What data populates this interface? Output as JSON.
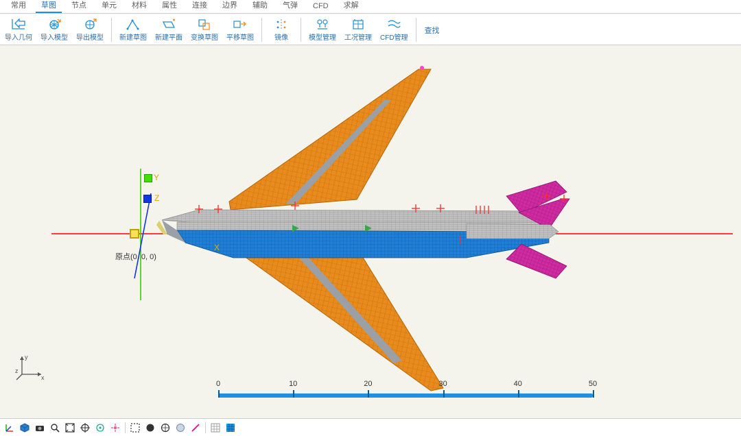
{
  "menu": {
    "tabs": [
      "常用",
      "草图",
      "节点",
      "单元",
      "材料",
      "属性",
      "连接",
      "边界",
      "辅助",
      "气弹",
      "CFD",
      "求解"
    ],
    "active_index": 1
  },
  "ribbon": {
    "buttons": [
      {
        "icon": "import-geometry",
        "label": "导入几何"
      },
      {
        "icon": "import-model",
        "label": "导入模型"
      },
      {
        "icon": "export-model",
        "label": "导出模型"
      },
      {
        "icon": "new-sketch",
        "label": "新建草图"
      },
      {
        "icon": "new-plane",
        "label": "新建平面"
      },
      {
        "icon": "transform-sketch",
        "label": "变换草图"
      },
      {
        "icon": "translate-sketch",
        "label": "平移草图"
      },
      {
        "icon": "mirror",
        "label": "镜像"
      },
      {
        "icon": "model-manage",
        "label": "模型管理"
      },
      {
        "icon": "loadcase-manage",
        "label": "工况管理"
      },
      {
        "icon": "cfd-manage",
        "label": "CFD管理"
      }
    ],
    "search_label": "查找",
    "separators_after": [
      2,
      6,
      7,
      10
    ]
  },
  "viewport": {
    "origin_label": "原点(0, 0, 0)",
    "axes": {
      "x": "X",
      "y": "Y",
      "z": "Z"
    },
    "triad": {
      "x": "x",
      "y": "y",
      "z": "z"
    },
    "ruler": {
      "ticks": [
        0,
        10,
        20,
        30,
        40,
        50
      ]
    },
    "colors": {
      "wing": "#e88b1f",
      "wing_grid": "#b86500",
      "fuselage_top": "#bcbcbc",
      "fuselage_grid": "#8f8f8f",
      "fuselage_bottom": "#1f7fd6",
      "fuselage_bottom_grid": "#0d4e8a",
      "tail": "#cf2aa0",
      "tail_grid": "#8d1670",
      "axis_x": "#ff0000",
      "axis_y": "#2fd000",
      "axis_z": "#1037e2"
    }
  },
  "bottom_toolbar": {
    "icons": [
      "axes-toggle",
      "iso-cube",
      "camera",
      "zoom",
      "fit",
      "target",
      "center",
      "locate",
      "sep",
      "select-rect",
      "shade-solid",
      "shade-wire",
      "shade-trans",
      "line",
      "sep",
      "grid-small",
      "grid-blue"
    ]
  }
}
